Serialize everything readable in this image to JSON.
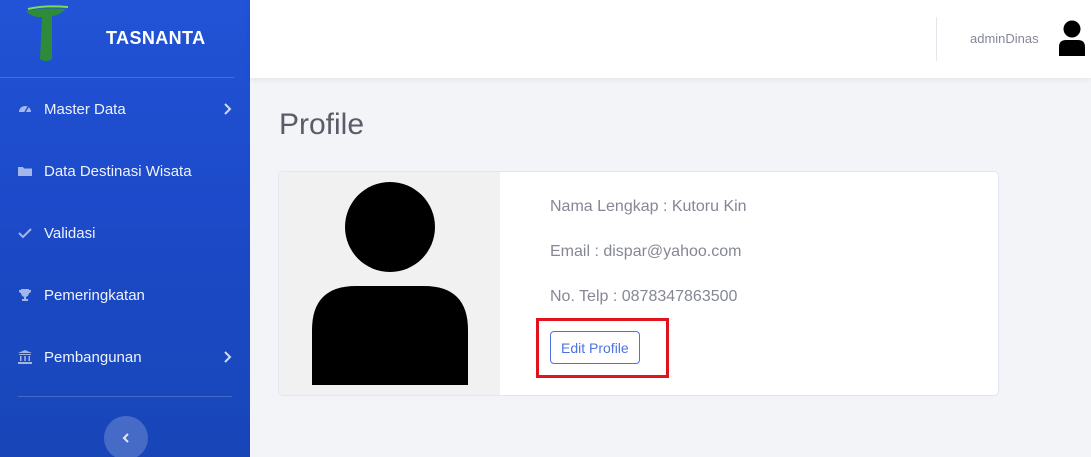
{
  "brand": {
    "name": "TASNANTA"
  },
  "sidebar": {
    "items": [
      {
        "label": "Master Data",
        "icon": "gauge-icon",
        "has_submenu": true
      },
      {
        "label": "Data Destinasi Wisata",
        "icon": "folder-icon",
        "has_submenu": false
      },
      {
        "label": "Validasi",
        "icon": "check-icon",
        "has_submenu": false
      },
      {
        "label": "Pemeringkatan",
        "icon": "trophy-icon",
        "has_submenu": false
      },
      {
        "label": "Pembangunan",
        "icon": "landmark-icon",
        "has_submenu": true
      }
    ],
    "toggle_icon": "chevron-left-icon"
  },
  "topbar": {
    "user_name": "adminDinas",
    "avatar_icon": "user-icon"
  },
  "page": {
    "title": "Profile"
  },
  "profile": {
    "full_name_line": "Nama Lengkap : Kutoru Kin",
    "email_line": "Email : dispar@yahoo.com",
    "phone_line": "No. Telp : 0878347863500",
    "edit_label": "Edit Profile"
  },
  "colors": {
    "sidebar": "#1c4ac9",
    "accent": "#4e73df",
    "highlight": "#e0131c"
  }
}
